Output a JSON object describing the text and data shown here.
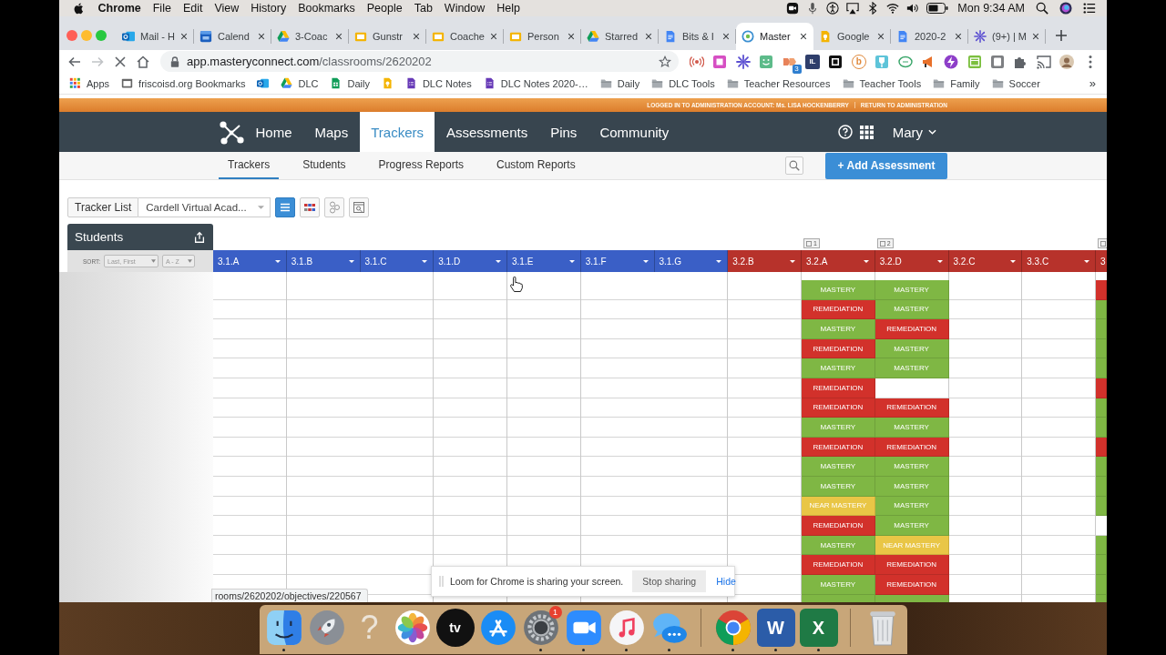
{
  "menubar": {
    "app": "Chrome",
    "menus": [
      "File",
      "Edit",
      "View",
      "History",
      "Bookmarks",
      "People",
      "Tab",
      "Window",
      "Help"
    ],
    "clock": "Mon 9:34 AM"
  },
  "browser": {
    "tabs": [
      {
        "kind": "mail",
        "title": "Mail - H",
        "selected": false
      },
      {
        "kind": "calendar",
        "title": "Calend",
        "selected": false
      },
      {
        "kind": "drive",
        "title": "3-Coac",
        "selected": false
      },
      {
        "kind": "slides",
        "title": "Gunstr",
        "selected": false
      },
      {
        "kind": "slides",
        "title": "Coache",
        "selected": false
      },
      {
        "kind": "slides",
        "title": "Person",
        "selected": false
      },
      {
        "kind": "drive",
        "title": "Starred",
        "selected": false
      },
      {
        "kind": "docs",
        "title": "Bits & I",
        "selected": false
      },
      {
        "kind": "ring",
        "title": "Master",
        "selected": true
      },
      {
        "kind": "keep",
        "title": "Google",
        "selected": false
      },
      {
        "kind": "docs",
        "title": "2020-2",
        "selected": false
      },
      {
        "kind": "flower",
        "title": "(9+) | M",
        "selected": false
      }
    ],
    "url_host": "app.masteryconnect.com",
    "url_path": "/classrooms/2620202",
    "toolbar_icons": [
      {
        "kind": "signal"
      },
      {
        "kind": "square"
      },
      {
        "kind": "flower"
      },
      {
        "kind": "smiley"
      },
      {
        "kind": "arrows",
        "badge": "3"
      },
      {
        "kind": "letters",
        "glyph": "IL"
      },
      {
        "kind": "frame"
      },
      {
        "kind": "letter-circle",
        "glyph": "b"
      },
      {
        "kind": "pin"
      },
      {
        "kind": "oval"
      },
      {
        "kind": "megaphone"
      },
      {
        "kind": "bolt"
      },
      {
        "kind": "window"
      },
      {
        "kind": "note"
      },
      {
        "kind": "puzzle"
      },
      {
        "kind": "cast"
      }
    ],
    "bookmarks": [
      {
        "kind": "apps",
        "label": "Apps"
      },
      {
        "kind": "page",
        "label": "friscoisd.org Bookmarks"
      },
      {
        "kind": "mail"
      },
      {
        "kind": "drive",
        "label": "DLC"
      },
      {
        "kind": "sheets",
        "label": "Daily"
      },
      {
        "kind": "keep"
      },
      {
        "kind": "forms",
        "label": "DLC Notes"
      },
      {
        "kind": "forms",
        "label": "DLC Notes 2020-…"
      },
      {
        "kind": "folder",
        "label": "Daily"
      },
      {
        "kind": "folder",
        "label": "DLC Tools"
      },
      {
        "kind": "folder",
        "label": "Teacher Resources"
      },
      {
        "kind": "folder",
        "label": "Teacher Tools"
      },
      {
        "kind": "folder",
        "label": "Family"
      },
      {
        "kind": "folder",
        "label": "Soccer"
      }
    ],
    "bookmarks_overflow": "»"
  },
  "admin_banner": {
    "account": "LOGGED IN TO ADMINISTRATION ACCOUNT: Ms. LISA HOCKENBERRY",
    "link": "RETURN TO ADMINISTRATION"
  },
  "nav": {
    "items": [
      {
        "label": "Home",
        "selected": false
      },
      {
        "label": "Maps",
        "selected": false
      },
      {
        "label": "Trackers",
        "selected": true
      },
      {
        "label": "Assessments",
        "selected": false
      },
      {
        "label": "Pins",
        "selected": false
      },
      {
        "label": "Community",
        "selected": false
      }
    ],
    "user": "Mary"
  },
  "subnav": {
    "items": [
      {
        "label": "Trackers",
        "selected": true
      },
      {
        "label": "Students",
        "selected": false
      },
      {
        "label": "Progress Reports",
        "selected": false
      },
      {
        "label": "Custom Reports",
        "selected": false
      }
    ],
    "action": "+ Add Assessment"
  },
  "toolbar": {
    "tracker_list": "Tracker List",
    "tracker": "Cardell Virtual Acad...",
    "views": [
      {
        "kind": "list",
        "selected": true
      },
      {
        "kind": "colors",
        "selected": false
      },
      {
        "kind": "nodes",
        "selected": false
      },
      {
        "kind": "zoom",
        "selected": false
      }
    ]
  },
  "students_panel": {
    "title": "Students",
    "sort_label": "SORT:",
    "sort_field": "Last, First",
    "sort_order": "A - Z"
  },
  "grid": {
    "columns": [
      {
        "label": "3.1.A",
        "color": "#3a5fc6",
        "marked": false
      },
      {
        "label": "3.1.B",
        "color": "#3a5fc6",
        "marked": false
      },
      {
        "label": "3.1.C",
        "color": "#3a5fc6",
        "marked": false
      },
      {
        "label": "3.1.D",
        "color": "#3a5fc6",
        "marked": false
      },
      {
        "label": "3.1.E",
        "color": "#3a5fc6",
        "marked": false
      },
      {
        "label": "3.1.F",
        "color": "#3a5fc6",
        "marked": false
      },
      {
        "label": "3.1.G",
        "color": "#3a5fc6",
        "marked": false
      },
      {
        "label": "3.2.B",
        "color": "#b7322b",
        "marked": false
      },
      {
        "label": "3.2.A",
        "color": "#b7322b",
        "marked": true,
        "marker_number": "1"
      },
      {
        "label": "3.2.D",
        "color": "#b7322b",
        "marked": true,
        "marker_number": "2"
      },
      {
        "label": "3.2.C",
        "color": "#b7322b",
        "marked": false
      },
      {
        "label": "3.3.C",
        "color": "#b7322b",
        "marked": false
      },
      {
        "label": "3",
        "color": "#b7322b",
        "marked": true
      }
    ],
    "rows": [
      {
        "cells": [
          null,
          null,
          null,
          null,
          null,
          null,
          null,
          null,
          {
            "label": "MASTERY",
            "color": "#7fb744"
          },
          {
            "label": "MASTERY",
            "color": "#7fb744"
          },
          null,
          null,
          {
            "color": "#d2312b"
          }
        ]
      },
      {
        "cells": [
          null,
          null,
          null,
          null,
          null,
          null,
          null,
          null,
          {
            "label": "REMEDIATION",
            "color": "#d2312b"
          },
          {
            "label": "MASTERY",
            "color": "#7fb744"
          },
          null,
          null,
          {
            "color": "#7fb744"
          }
        ]
      },
      {
        "cells": [
          null,
          null,
          null,
          null,
          null,
          null,
          null,
          null,
          {
            "label": "MASTERY",
            "color": "#7fb744"
          },
          {
            "label": "REMEDIATION",
            "color": "#d2312b"
          },
          null,
          null,
          {
            "color": "#7fb744"
          }
        ]
      },
      {
        "cells": [
          null,
          null,
          null,
          null,
          null,
          null,
          null,
          null,
          {
            "label": "REMEDIATION",
            "color": "#d2312b"
          },
          {
            "label": "MASTERY",
            "color": "#7fb744"
          },
          null,
          null,
          {
            "color": "#7fb744"
          }
        ]
      },
      {
        "cells": [
          null,
          null,
          null,
          null,
          null,
          null,
          null,
          null,
          {
            "label": "MASTERY",
            "color": "#7fb744"
          },
          {
            "label": "MASTERY",
            "color": "#7fb744"
          },
          null,
          null,
          {
            "color": "#7fb744"
          }
        ]
      },
      {
        "cells": [
          null,
          null,
          null,
          null,
          null,
          null,
          null,
          null,
          {
            "label": "REMEDIATION",
            "color": "#d2312b"
          },
          null,
          null,
          null,
          {
            "color": "#d2312b"
          }
        ]
      },
      {
        "cells": [
          null,
          null,
          null,
          null,
          null,
          null,
          null,
          null,
          {
            "label": "REMEDIATION",
            "color": "#d2312b"
          },
          {
            "label": "REMEDIATION",
            "color": "#d2312b"
          },
          null,
          null,
          {
            "color": "#7fb744"
          }
        ]
      },
      {
        "cells": [
          null,
          null,
          null,
          null,
          null,
          null,
          null,
          null,
          {
            "label": "MASTERY",
            "color": "#7fb744"
          },
          {
            "label": "MASTERY",
            "color": "#7fb744"
          },
          null,
          null,
          {
            "color": "#7fb744"
          }
        ]
      },
      {
        "cells": [
          null,
          null,
          null,
          null,
          null,
          null,
          null,
          null,
          {
            "label": "REMEDIATION",
            "color": "#d2312b"
          },
          {
            "label": "REMEDIATION",
            "color": "#d2312b"
          },
          null,
          null,
          {
            "color": "#d2312b"
          }
        ]
      },
      {
        "cells": [
          null,
          null,
          null,
          null,
          null,
          null,
          null,
          null,
          {
            "label": "MASTERY",
            "color": "#7fb744"
          },
          {
            "label": "MASTERY",
            "color": "#7fb744"
          },
          null,
          null,
          {
            "color": "#7fb744"
          }
        ]
      },
      {
        "cells": [
          null,
          null,
          null,
          null,
          null,
          null,
          null,
          null,
          {
            "label": "MASTERY",
            "color": "#7fb744"
          },
          {
            "label": "MASTERY",
            "color": "#7fb744"
          },
          null,
          null,
          {
            "color": "#7fb744"
          }
        ]
      },
      {
        "cells": [
          null,
          null,
          null,
          null,
          null,
          null,
          null,
          null,
          {
            "label": "NEAR MASTERY",
            "color": "#e9c646"
          },
          {
            "label": "MASTERY",
            "color": "#7fb744"
          },
          null,
          null,
          {
            "color": "#7fb744"
          }
        ]
      },
      {
        "cells": [
          null,
          null,
          null,
          null,
          null,
          null,
          null,
          null,
          {
            "label": "REMEDIATION",
            "color": "#d2312b"
          },
          {
            "label": "MASTERY",
            "color": "#7fb744"
          },
          null,
          null,
          null
        ]
      },
      {
        "cells": [
          null,
          null,
          null,
          null,
          null,
          null,
          null,
          null,
          {
            "label": "MASTERY",
            "color": "#7fb744"
          },
          {
            "label": "NEAR MASTERY",
            "color": "#e9c646"
          },
          null,
          null,
          {
            "color": "#7fb744"
          }
        ]
      },
      {
        "cells": [
          null,
          null,
          null,
          null,
          null,
          null,
          null,
          null,
          {
            "label": "REMEDIATION",
            "color": "#d2312b"
          },
          {
            "label": "REMEDIATION",
            "color": "#d2312b"
          },
          null,
          null,
          {
            "color": "#7fb744"
          }
        ]
      },
      {
        "cells": [
          null,
          null,
          null,
          null,
          null,
          null,
          null,
          null,
          {
            "label": "MASTERY",
            "color": "#7fb744"
          },
          {
            "label": "REMEDIATION",
            "color": "#d2312b"
          },
          null,
          null,
          {
            "color": "#7fb744"
          }
        ]
      },
      {
        "cells": [
          null,
          null,
          null,
          null,
          null,
          null,
          null,
          null,
          {
            "color": "#7fb744"
          },
          {
            "color": "#7fb744"
          },
          null,
          null,
          {
            "color": "#7fb744"
          }
        ]
      }
    ]
  },
  "status_url": "rooms/2620202/objectives/220567",
  "loom": {
    "message": "Loom for Chrome is sharing your screen.",
    "stop": "Stop sharing",
    "hide": "Hide"
  },
  "dock": {
    "groups": [
      {
        "items": [
          {
            "kind": "face",
            "running": true
          },
          {
            "kind": "rocket",
            "running": false
          },
          {
            "kind": "question",
            "glyph": "?",
            "running": false
          },
          {
            "kind": "photos",
            "running": false
          },
          {
            "kind": "tv",
            "glyph": "tv",
            "running": false
          },
          {
            "kind": "strokes",
            "running": false
          },
          {
            "kind": "gear",
            "badge": "1",
            "running": true
          },
          {
            "kind": "camera",
            "running": true
          },
          {
            "kind": "music",
            "running": true
          },
          {
            "kind": "chat",
            "running": true
          }
        ]
      },
      {
        "items": [
          {
            "kind": "browser",
            "running": true
          },
          {
            "kind": "doc",
            "glyph": "W",
            "running": true
          },
          {
            "kind": "sheet",
            "glyph": "X",
            "running": true
          }
        ]
      },
      {
        "items": [
          {
            "kind": "trash",
            "running": false
          }
        ]
      }
    ]
  }
}
